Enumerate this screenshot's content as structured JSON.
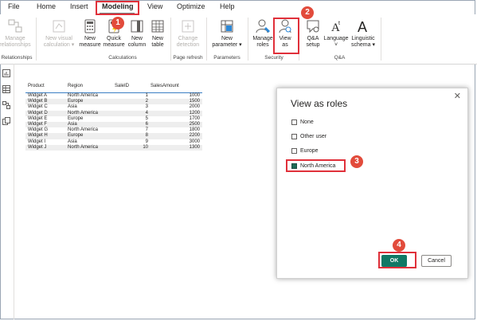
{
  "tabs": [
    "File",
    "Home",
    "Insert",
    "Modeling",
    "View",
    "Optimize",
    "Help"
  ],
  "ribbon": {
    "manage_relationships": [
      "Manage",
      "relationships"
    ],
    "new_visual_calc": [
      "New visual",
      "calculation"
    ],
    "new_measure": [
      "New",
      "measure"
    ],
    "quick_measure": [
      "Quick",
      "measure"
    ],
    "new_column": [
      "New",
      "column"
    ],
    "new_table": [
      "New",
      "table"
    ],
    "change_detection": [
      "Change",
      "detection"
    ],
    "new_parameter": [
      "New",
      "parameter"
    ],
    "manage_roles": [
      "Manage",
      "roles"
    ],
    "view_as": [
      "View",
      "as"
    ],
    "qa_setup": [
      "Q&A",
      "setup"
    ],
    "language": [
      "Language",
      "˅"
    ],
    "linguistic_schema": [
      "Linguistic",
      "schema"
    ],
    "groups": {
      "relationships": "Relationships",
      "calculations": "Calculations",
      "page_refresh": "Page refresh",
      "parameters": "Parameters",
      "security": "Security",
      "qa": "Q&A"
    }
  },
  "table": {
    "headers": [
      "Product",
      "Region",
      "SaleID",
      "SalesAmount"
    ],
    "rows": [
      [
        "Widget A",
        "North America",
        "1",
        "1000"
      ],
      [
        "Widget B",
        "Europe",
        "2",
        "1500"
      ],
      [
        "Widget C",
        "Asia",
        "3",
        "2000"
      ],
      [
        "Widget D",
        "North America",
        "4",
        "1200"
      ],
      [
        "Widget E",
        "Europe",
        "5",
        "1700"
      ],
      [
        "Widget F",
        "Asia",
        "6",
        "2500"
      ],
      [
        "Widget G",
        "North America",
        "7",
        "1800"
      ],
      [
        "Widget H",
        "Europe",
        "8",
        "2200"
      ],
      [
        "Widget I",
        "Asia",
        "9",
        "3000"
      ],
      [
        "Widget J",
        "North America",
        "10",
        "1300"
      ]
    ]
  },
  "dialog": {
    "title": "View as roles",
    "close": "✕",
    "options": [
      {
        "label": "None",
        "checked": false
      },
      {
        "label": "Other user",
        "checked": false
      },
      {
        "label": "Europe",
        "checked": false
      },
      {
        "label": "North America",
        "checked": true
      }
    ],
    "ok_label": "OK",
    "cancel_label": "Cancel"
  },
  "annotations": [
    "1",
    "2",
    "3",
    "4"
  ],
  "colors": {
    "accent": "#117865",
    "annotation_red": "#e0303a",
    "table_header_line": "#3b7fc4"
  }
}
